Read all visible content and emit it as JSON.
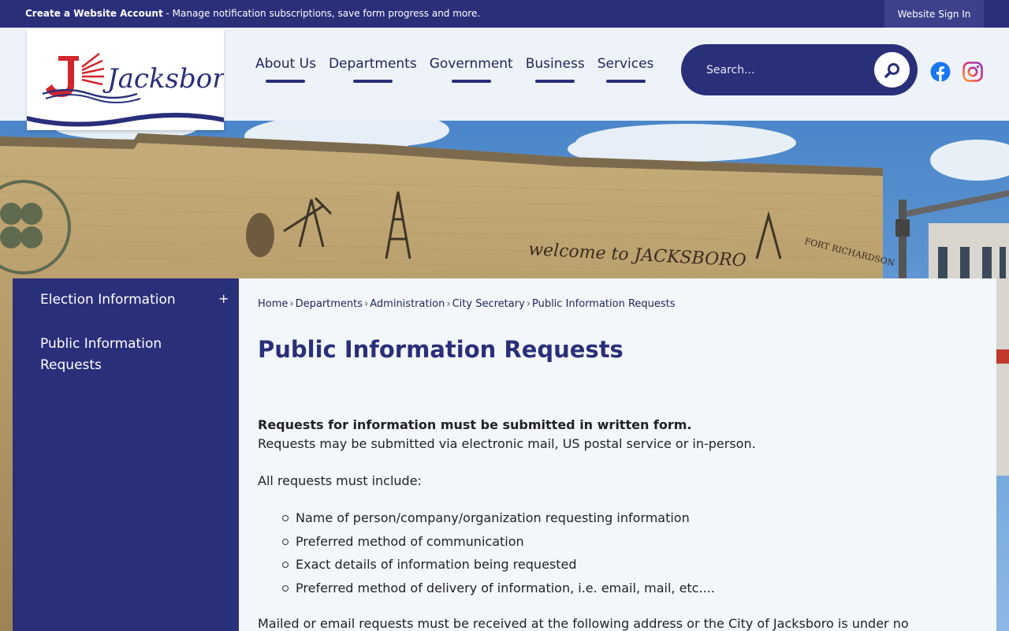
{
  "topbar": {
    "create_account": "Create a Website Account",
    "create_account_desc": " - Manage notification subscriptions, save form progress and more.",
    "sign_in": "Website Sign In"
  },
  "logo": {
    "text": "Jacksboro",
    "alt": "Jacksboro"
  },
  "nav": {
    "items": [
      {
        "label": "About Us"
      },
      {
        "label": "Departments"
      },
      {
        "label": "Government"
      },
      {
        "label": "Business"
      },
      {
        "label": "Services"
      }
    ]
  },
  "search": {
    "placeholder": "Search..."
  },
  "social": {
    "facebook": "facebook-icon",
    "instagram": "instagram-icon"
  },
  "hero": {
    "mural_text": "welcome to JACKSBORO",
    "sign_text": "FORT RICHARDSON"
  },
  "sidebar": {
    "items": [
      {
        "label": "Election Information",
        "expand": "+"
      },
      {
        "label": "Public Information Requests"
      }
    ]
  },
  "breadcrumb": {
    "items": [
      "Home",
      "Departments",
      "Administration",
      "City Secretary",
      "Public Information Requests"
    ],
    "separator": "›"
  },
  "page": {
    "title": "Public Information Requests",
    "bold_intro": "Requests for information must be submitted in written form.",
    "intro": "Requests may be submitted via electronic mail, US postal service or in-person.",
    "must_include": "All requests must include:",
    "requirements": [
      "Name of person/company/organization requesting information",
      "Preferred method of communication",
      "Exact details of information being requested",
      "Preferred method of delivery of information, i.e. email, mail, etc...."
    ],
    "mailed_note": "Mailed or email requests must be received at the following address or the City of Jacksboro is under no"
  },
  "colors": {
    "primary": "#2a2f7a",
    "background": "#eef3fa",
    "content_bg": "#f3f7fc",
    "logo_red": "#d1262c"
  }
}
